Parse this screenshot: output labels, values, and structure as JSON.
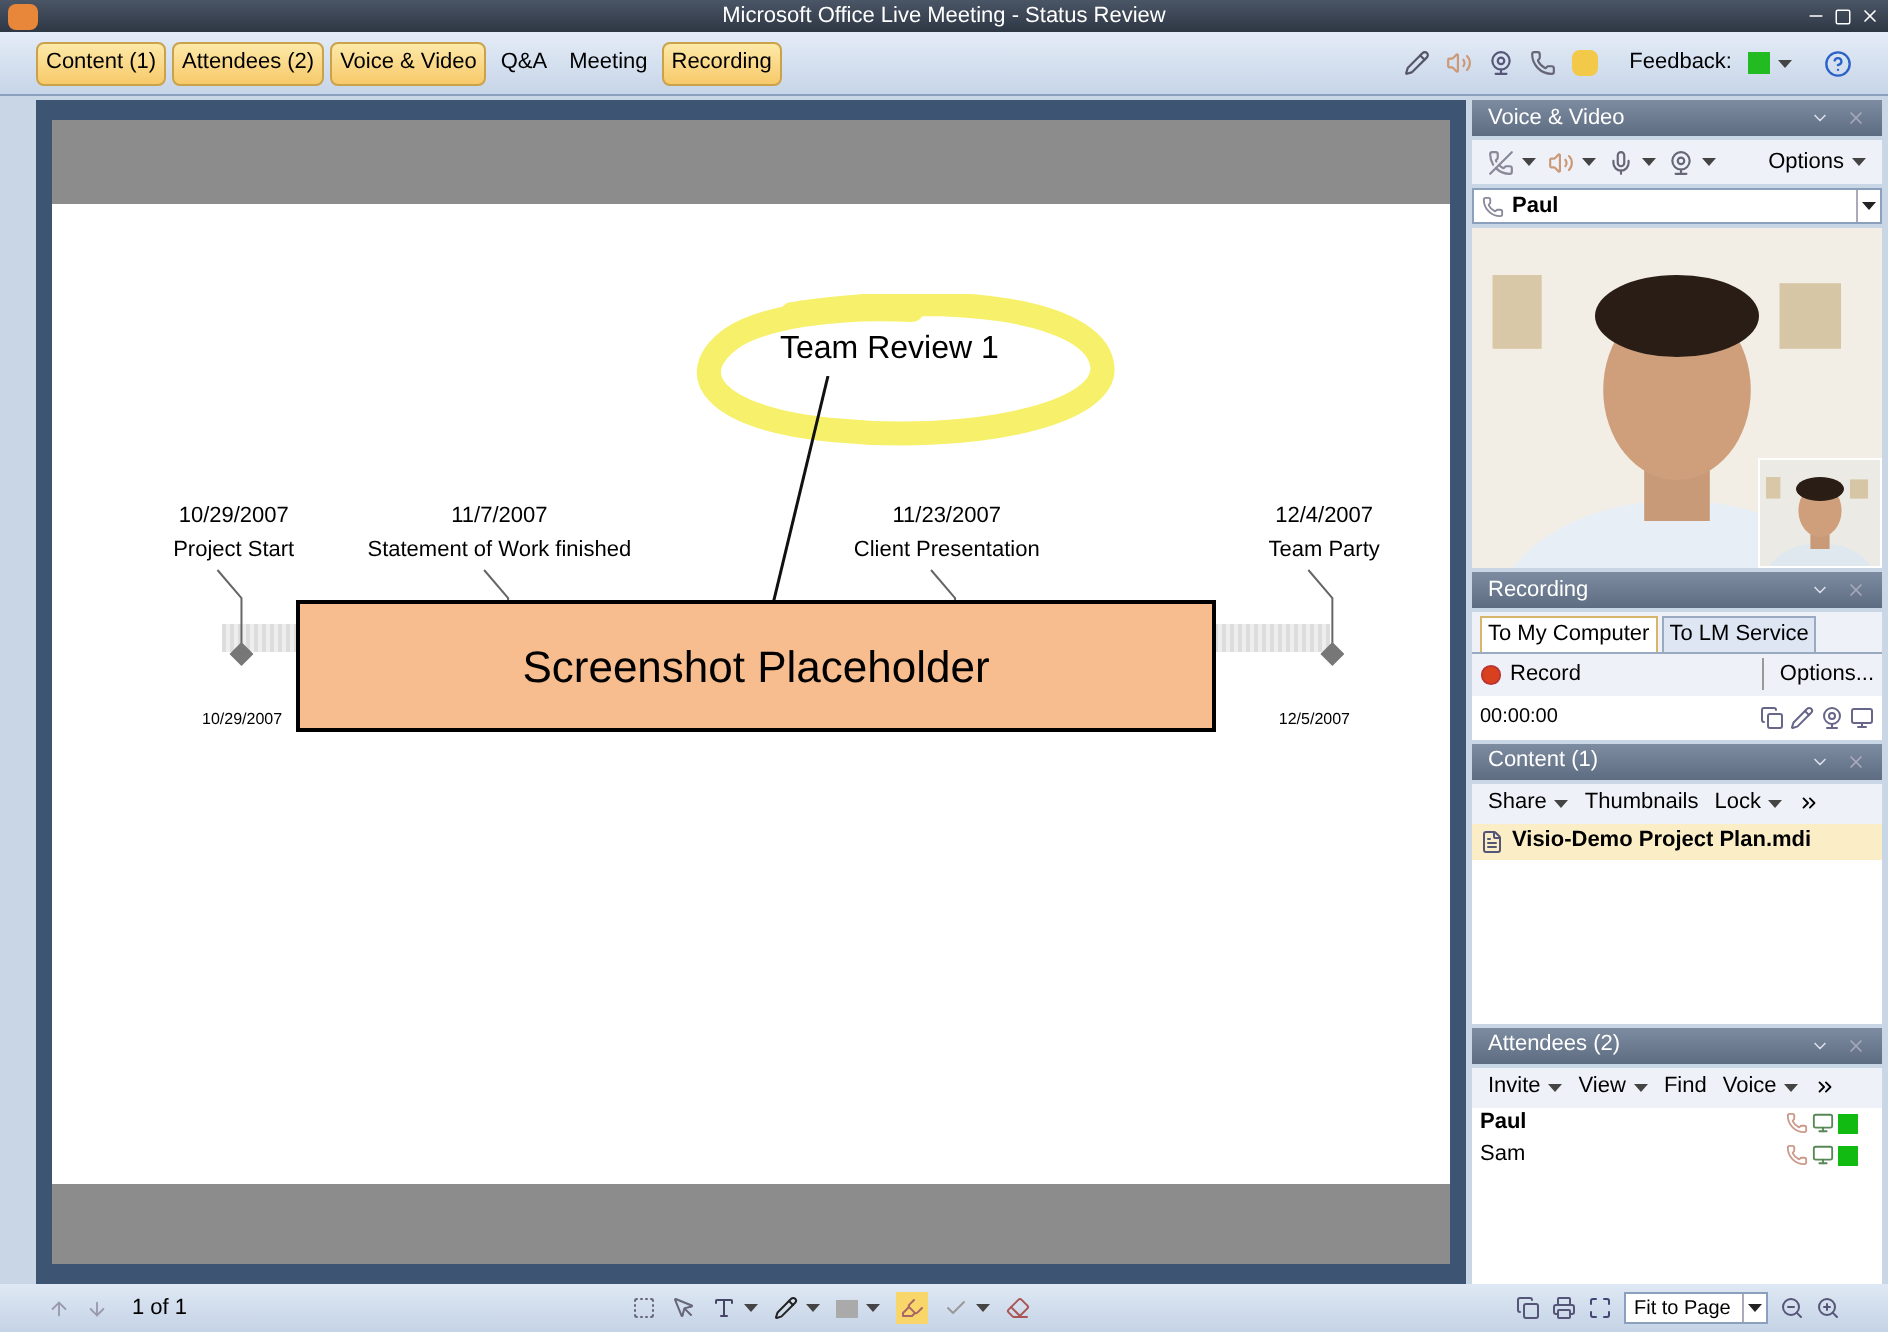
{
  "window": {
    "title": "Microsoft Office Live Meeting - Status Review"
  },
  "pane_tabs": [
    {
      "label": "Content (1)",
      "active": true
    },
    {
      "label": "Attendees (2)",
      "active": true
    },
    {
      "label": "Voice & Video",
      "active": true
    },
    {
      "label": "Q&A",
      "active": false
    },
    {
      "label": "Meeting",
      "active": false
    },
    {
      "label": "Recording",
      "active": true
    }
  ],
  "feedback": {
    "label": "Feedback:",
    "color": "#22bb22"
  },
  "slide": {
    "title": "Team Review 1",
    "milestones": [
      {
        "date": "10/29/2007",
        "label": "Project Start"
      },
      {
        "date": "11/7/2007",
        "label": "Statement of Work finished"
      },
      {
        "date": "11/23/2007",
        "label": "Client Presentation"
      },
      {
        "date": "12/4/2007",
        "label": "Team Party"
      }
    ],
    "axis_start": "10/29/2007",
    "axis_end": "12/5/2007",
    "overlay": "Screenshot Placeholder"
  },
  "voice_video": {
    "title": "Voice & Video",
    "options": "Options",
    "participant": "Paul"
  },
  "recording": {
    "title": "Recording",
    "tabs": [
      {
        "label": "To My Computer",
        "selected": true
      },
      {
        "label": "To LM Service",
        "selected": false
      }
    ],
    "record": "Record",
    "options": "Options...",
    "time": "00:00:00"
  },
  "content": {
    "title": "Content (1)",
    "toolbar": [
      "Share",
      "Thumbnails",
      "Lock"
    ],
    "files": [
      {
        "name": "Visio-Demo Project Plan.mdi",
        "selected": true
      }
    ]
  },
  "attendees": {
    "title": "Attendees (2)",
    "toolbar": [
      "Invite",
      "View",
      "Find",
      "Voice"
    ],
    "people": [
      {
        "name": "Paul",
        "presenter": true,
        "color": "#11bb11"
      },
      {
        "name": "Sam",
        "presenter": false,
        "color": "#11bb11"
      }
    ]
  },
  "status_bar": {
    "page": "1 of 1",
    "zoom": "Fit to Page"
  }
}
